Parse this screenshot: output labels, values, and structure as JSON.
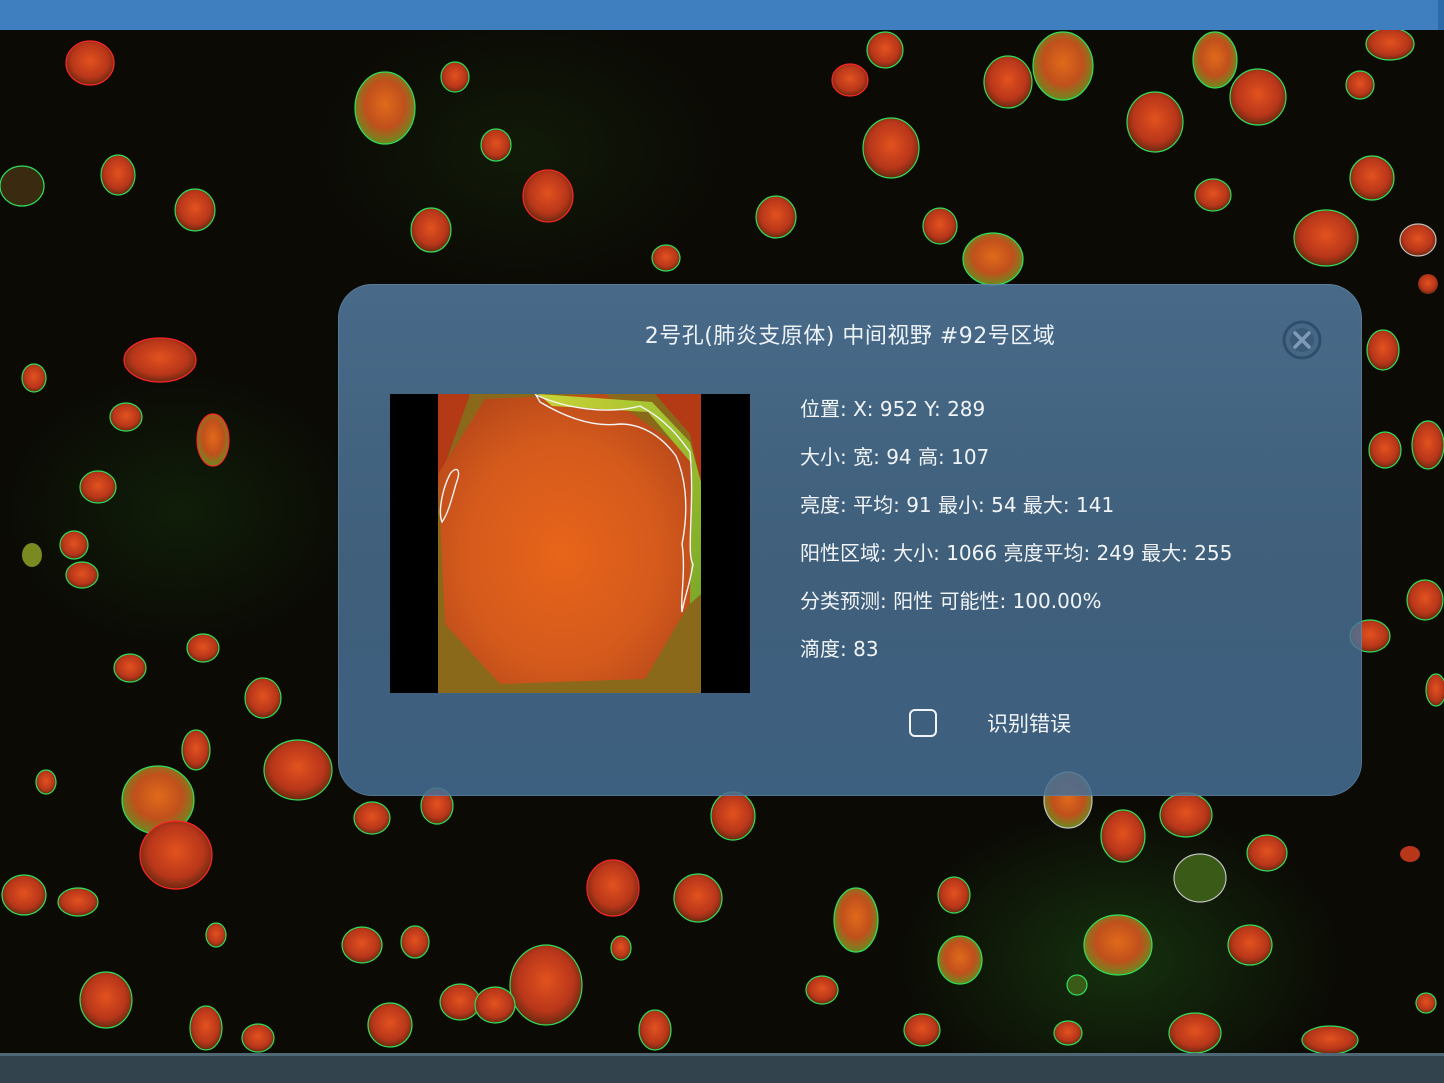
{
  "colors": {
    "titlebar": "#3f7fbf",
    "dialog_background": "#527a9e",
    "cell_red": "#d8401c",
    "cell_green": "#7fd43a",
    "contour_green": "#2ee05a",
    "contour_red": "#ff2020"
  },
  "dialog": {
    "title": "2号孔(肺炎支原体) 中间视野 #92号区域",
    "close_icon": "close-circle-icon",
    "info": {
      "position": "位置: X: 952 Y: 289",
      "size": "大小: 宽: 94 高: 107",
      "brightness": "亮度: 平均: 91 最小: 54 最大: 141",
      "positive_region": "阳性区域:  大小: 1066 亮度平均: 249 最大: 255",
      "prediction": "分类预测: 阳性 可能性: 100.00%",
      "titer": "滴度: 83"
    },
    "recognition_error": {
      "label": "识别错误",
      "checked": false
    }
  }
}
